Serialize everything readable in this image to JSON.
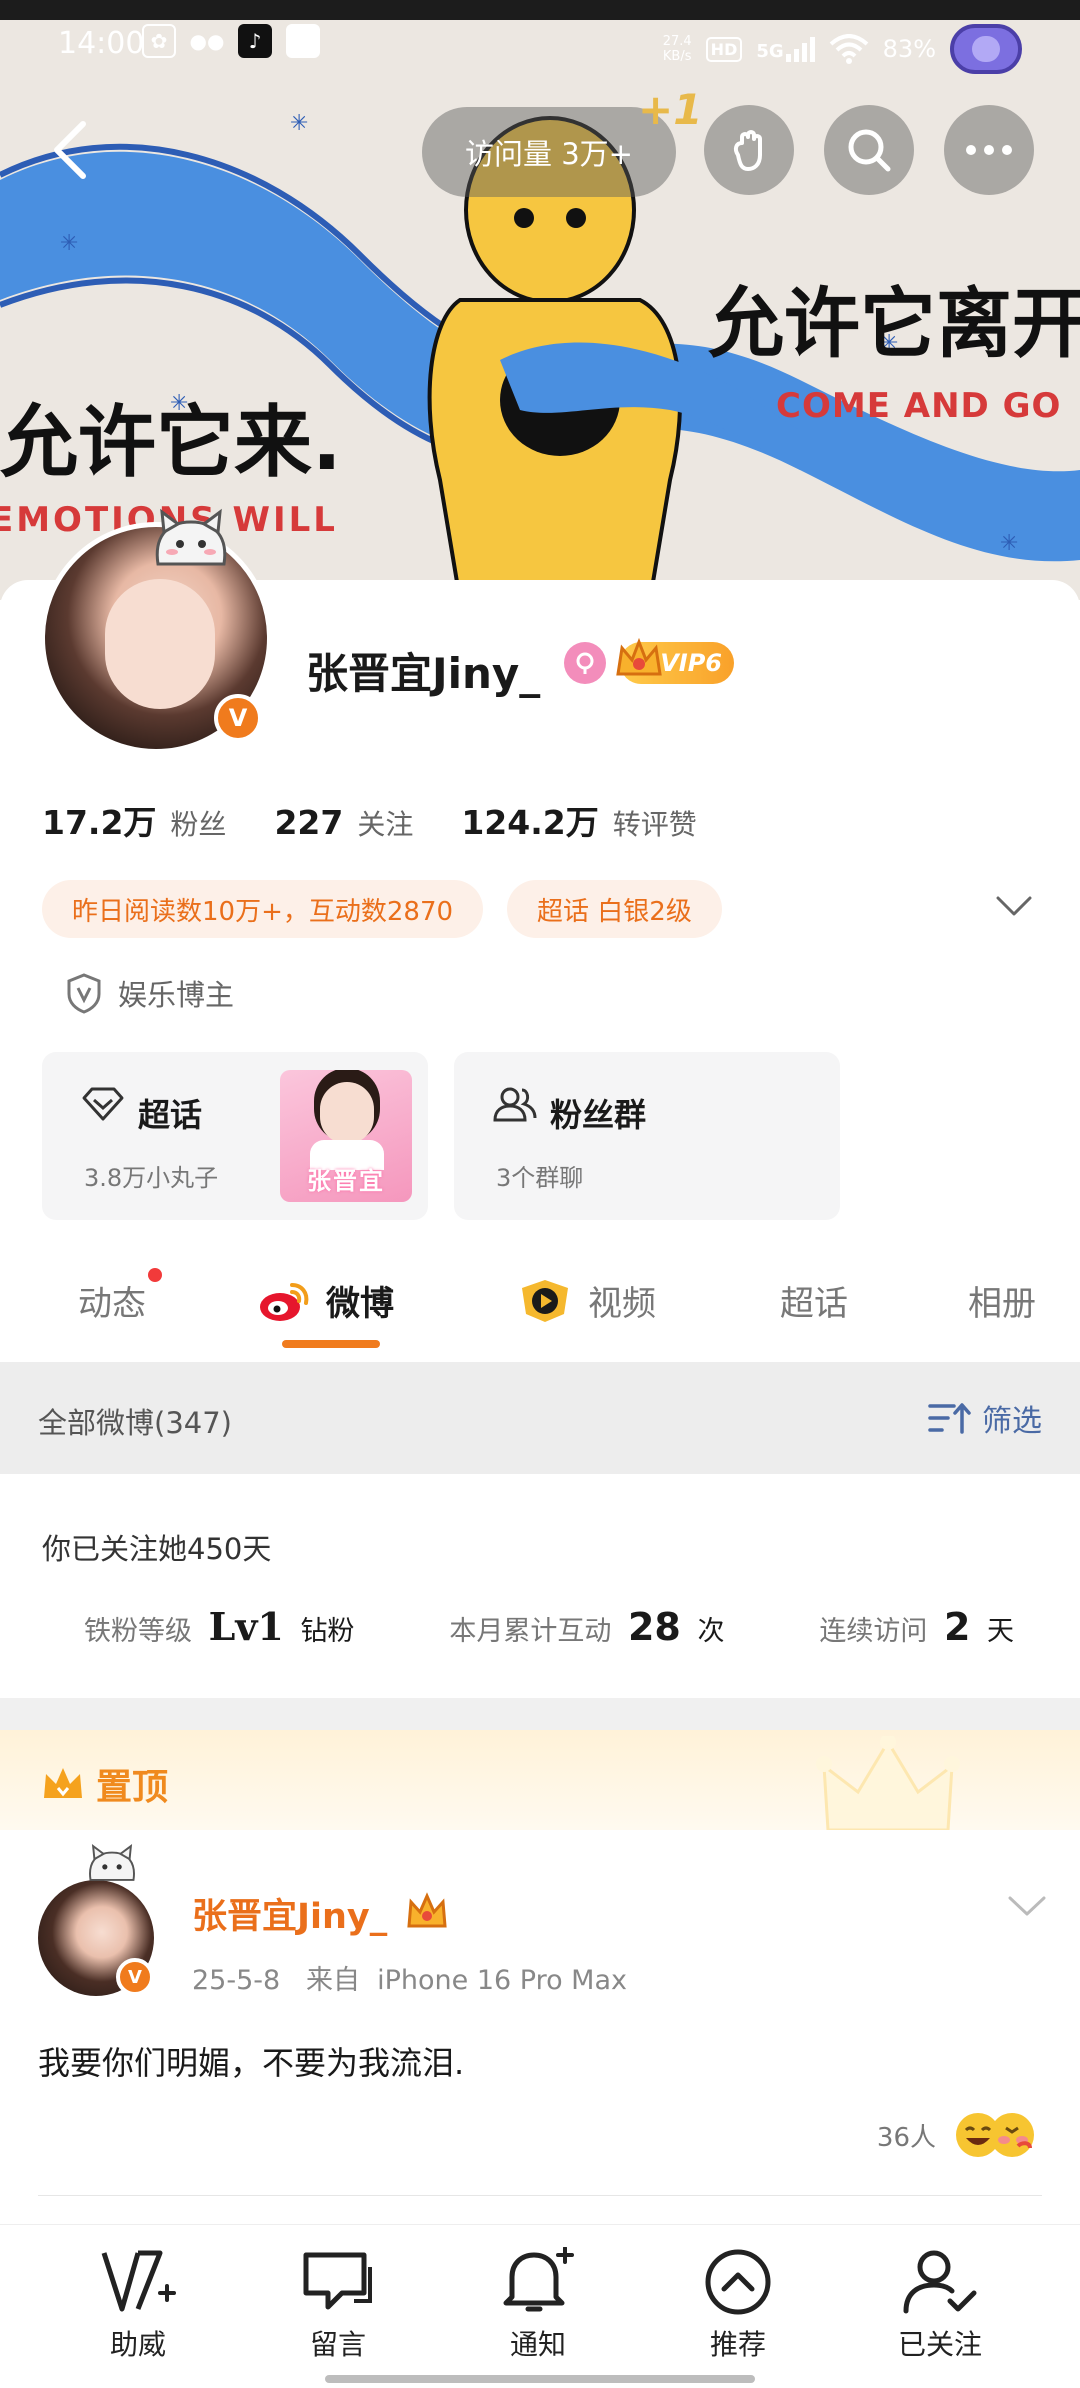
{
  "status_bar": {
    "time": "14:00",
    "net_speed_top": "27.4",
    "net_speed_unit": "KB/s",
    "hd": "HD",
    "network": "5G",
    "battery": "83%"
  },
  "banner": {
    "text_left": "允许它来.",
    "text_left_en": "EMOTIONS WILL",
    "text_right": "允许它离开",
    "text_right_en": "COME AND GO"
  },
  "topnav": {
    "visits_label": "访问量 3万+",
    "plus_one": "+1"
  },
  "profile": {
    "name": "张晋宜Jiny_",
    "vip_label": "VIP6",
    "verify_mark": "V",
    "stats": [
      {
        "value": "17.2万",
        "label": "粉丝"
      },
      {
        "value": "227",
        "label": "关注"
      },
      {
        "value": "124.2万",
        "label": "转评赞"
      }
    ],
    "tags": [
      "昨日阅读数10万+，互动数2870",
      "超话 白银2级"
    ],
    "category": "娱乐博主",
    "cards": [
      {
        "title": "超话",
        "subtitle": "3.8万小丸子",
        "thumb_text": "张晋宜"
      },
      {
        "title": "粉丝群",
        "subtitle": "3个群聊"
      }
    ]
  },
  "tabs": [
    "动态",
    "微博",
    "视频",
    "超话",
    "相册"
  ],
  "active_tab": "微博",
  "list_header": {
    "title": "全部微博(347)",
    "filter_label": "筛选"
  },
  "follow": {
    "text": "你已关注她450天",
    "items": [
      {
        "label": "铁粉等级",
        "value": "Lv1",
        "unit": "钻粉"
      },
      {
        "label": "本月累计互动",
        "value": "28",
        "unit": "次"
      },
      {
        "label": "连续访问",
        "value": "2",
        "unit": "天"
      }
    ]
  },
  "pinned": {
    "label": "置顶"
  },
  "post": {
    "author": "张晋宜Jiny_",
    "meta": "25-5-8   来自  iPhone 16 Pro Max",
    "text": "我要你们明媚，不要为我流泪.",
    "reaction_count": "36人"
  },
  "bottom_nav": [
    {
      "label": "助威",
      "icon": "cheer-icon"
    },
    {
      "label": "留言",
      "icon": "message-icon"
    },
    {
      "label": "通知",
      "icon": "bell-plus-icon"
    },
    {
      "label": "推荐",
      "icon": "recommend-icon"
    },
    {
      "label": "已关注",
      "icon": "user-check-icon"
    }
  ],
  "colors": {
    "accent_orange": "#f07b1d",
    "tag_bg": "#fdf0e8",
    "link_blue": "#4a6aa5",
    "river_blue": "#4a8fe0",
    "character_yellow": "#f6c640"
  }
}
